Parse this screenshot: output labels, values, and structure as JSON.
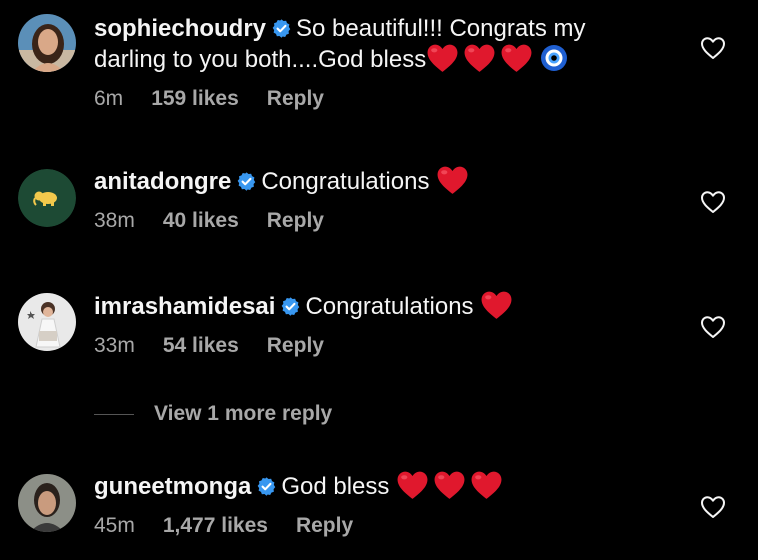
{
  "comments": [
    {
      "username": "sophiechoudry",
      "text_line1": "So beautiful!!! Congrats my",
      "text_line2": "darling to you both....God bless",
      "time": "6m",
      "likes": "159 likes",
      "reply": "Reply"
    },
    {
      "username": "anitadongre",
      "text": "Congratulations",
      "time": "38m",
      "likes": "40 likes",
      "reply": "Reply"
    },
    {
      "username": "imrashamidesai",
      "text": "Congratulations",
      "time": "33m",
      "likes": "54 likes",
      "reply": "Reply"
    },
    {
      "username": "guneetmonga",
      "text": "God bless",
      "time": "45m",
      "likes": "1,477 likes",
      "reply": "Reply"
    }
  ],
  "view_more_replies": "View 1 more reply",
  "icons": {
    "verified": "verified-badge-icon",
    "heart_emoji": "red-heart-emoji",
    "evil_eye": "nazar-amulet-emoji",
    "like": "heart-outline-icon"
  },
  "colors": {
    "background": "#000000",
    "text": "#f5f5f5",
    "secondary": "#a8a8a8",
    "verified": "#3897f0",
    "heart": "#e0182d"
  }
}
